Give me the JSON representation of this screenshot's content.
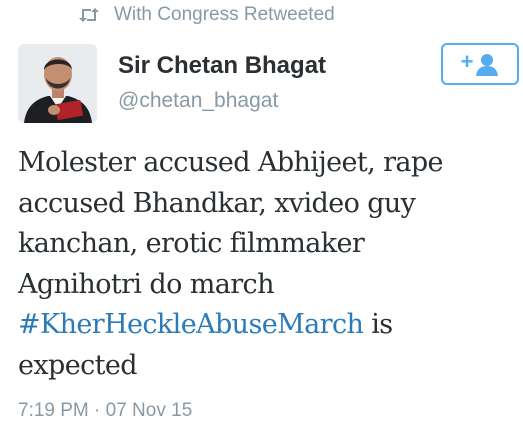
{
  "retweet": {
    "icon": "retweet-icon",
    "text": "With Congress Retweeted"
  },
  "author": {
    "display_name": "Sir Chetan Bhagat",
    "handle": "@chetan_bhagat",
    "avatar_icon": "avatar-photo"
  },
  "follow_button": {
    "plus": "+",
    "icon": "person-icon"
  },
  "tweet": {
    "line1": "Molester accused Abhijeet, rape",
    "line2": "accused Bhandkar, xvideo guy",
    "line3": "kanchan, erotic filmmaker",
    "line4": "Agnihotri do march",
    "hashtag": "#KherHeckleAbuseMarch",
    "after_hashtag": " is",
    "line6": "expected"
  },
  "timestamp": "7:19 PM · 07 Nov 15",
  "colors": {
    "link": "#2b7bb9",
    "muted": "#8899a6",
    "accent": "#55acee",
    "text": "#292f33"
  }
}
